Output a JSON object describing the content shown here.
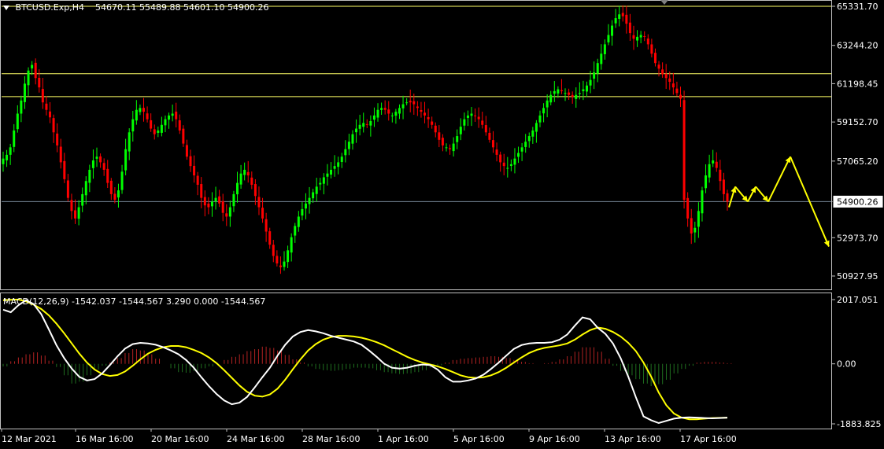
{
  "main_header": {
    "symbol": "BTCUSD.Exp,H4",
    "open": "54670.11",
    "high": "55489.88",
    "low": "54601.10",
    "close": "54900.26"
  },
  "macd_header": {
    "label": "MACD(12,26,9)",
    "values": "-1542.037 -1544.567 3.290 0.000 -1544.567"
  },
  "chart_data": [
    {
      "type": "candlestick",
      "title": "BTCUSD.Exp,H4",
      "ylim": [
        50300,
        65600
      ],
      "price_ticks": [
        "65331.70",
        "63244.20",
        "61198.45",
        "59152.70",
        "57065.20",
        "54900.26",
        "52973.70",
        "50927.95"
      ],
      "current_price": "54900.26",
      "horizontal_levels": [
        65331.7,
        61730,
        60510
      ],
      "colors": {
        "bull": "#00ff00",
        "bear": "#ff0000",
        "level": "#ffff66",
        "current": "#778899",
        "forecast": "#ffff00"
      },
      "x_labels": [
        "12 Mar 2021",
        "16 Mar 16:00",
        "20 Mar 16:00",
        "24 Mar 16:00",
        "28 Mar 16:00",
        "1 Apr 16:00",
        "5 Apr 16:00",
        "9 Apr 16:00",
        "13 Apr 16:00",
        "17 Apr 16:00"
      ],
      "close_path": [
        57200,
        57400,
        57800,
        58700,
        59600,
        60300,
        61200,
        61900,
        62200,
        61500,
        61000,
        60200,
        59800,
        59400,
        58600,
        57900,
        57000,
        56100,
        55100,
        54400,
        54000,
        54600,
        55300,
        56000,
        56600,
        57100,
        57300,
        57000,
        56600,
        55900,
        55300,
        55000,
        55500,
        56500,
        57700,
        58600,
        59300,
        59800,
        59900,
        59700,
        59300,
        58800,
        58500,
        58700,
        59000,
        59300,
        59500,
        59600,
        59300,
        58700,
        58000,
        57300,
        56800,
        56300,
        55800,
        55100,
        54700,
        54600,
        54900,
        55100,
        54800,
        54300,
        54100,
        54600,
        55300,
        55900,
        56400,
        56600,
        56300,
        55800,
        55200,
        54600,
        54000,
        53300,
        52600,
        52000,
        51600,
        51400,
        51700,
        52300,
        53000,
        53600,
        54100,
        54500,
        54800,
        55100,
        55400,
        55700,
        55900,
        56200,
        56400,
        56600,
        56800,
        57000,
        57300,
        57700,
        58100,
        58500,
        58800,
        59000,
        59100,
        59000,
        59200,
        59500,
        59800,
        59900,
        59800,
        59600,
        59500,
        59700,
        59900,
        60100,
        60200,
        60200,
        60100,
        59900,
        59700,
        59500,
        59300,
        59000,
        58600,
        58200,
        57900,
        57800,
        57700,
        58000,
        58400,
        58900,
        59300,
        59500,
        59600,
        59500,
        59300,
        59000,
        58600,
        58200,
        57800,
        57400,
        57000,
        56800,
        56700,
        56900,
        57200,
        57500,
        57800,
        58100,
        58400,
        58700,
        59100,
        59500,
        59900,
        60300,
        60600,
        60800,
        60900,
        60800,
        60700,
        60600,
        60500,
        60600,
        60700,
        60900,
        61100,
        61400,
        61800,
        62300,
        62800,
        63300,
        63800,
        64300,
        64700,
        64900,
        64800,
        64400,
        63900,
        63600,
        63700,
        63800,
        63700,
        63300,
        62800,
        62300,
        62000,
        61700,
        61500,
        61300,
        61000,
        60700,
        60400,
        55000,
        54000,
        53200,
        53500,
        54400,
        55500,
        56300,
        56900,
        57100,
        56700,
        56000,
        55300,
        54900
      ],
      "forecast_path": [
        54600,
        55700,
        54900,
        55700,
        54900,
        57300,
        52500
      ]
    },
    {
      "type": "macd",
      "title": "MACD(12,26,9)",
      "params": [
        12,
        26,
        9
      ],
      "ylim": [
        -2150,
        2150
      ],
      "ticks": [
        "2017.051",
        "0.00",
        "-1883.825"
      ],
      "macd_line": [
        1700,
        1620,
        1840,
        2000,
        1880,
        1560,
        1080,
        580,
        180,
        -150,
        -410,
        -520,
        -480,
        -300,
        -40,
        240,
        480,
        620,
        660,
        640,
        600,
        520,
        420,
        300,
        120,
        -120,
        -420,
        -700,
        -950,
        -1150,
        -1270,
        -1220,
        -1040,
        -740,
        -420,
        -120,
        260,
        600,
        860,
        1000,
        1060,
        1020,
        960,
        880,
        820,
        760,
        700,
        600,
        420,
        220,
        0,
        -120,
        -150,
        -120,
        -60,
        -20,
        -40,
        -180,
        -420,
        -560,
        -560,
        -520,
        -460,
        -340,
        -160,
        40,
        260,
        470,
        590,
        640,
        660,
        660,
        680,
        760,
        920,
        1200,
        1460,
        1400,
        1130,
        940,
        640,
        180,
        -400,
        -1050,
        -1650,
        -1770,
        -1860,
        -1790,
        -1720,
        -1690,
        -1680,
        -1690,
        -1700,
        -1710,
        -1700,
        -1690
      ],
      "signal_line": [
        2000,
        2010,
        2020,
        1960,
        1860,
        1720,
        1520,
        1260,
        960,
        640,
        320,
        40,
        -180,
        -320,
        -380,
        -350,
        -240,
        -60,
        140,
        320,
        440,
        520,
        560,
        560,
        520,
        440,
        340,
        200,
        20,
        -200,
        -440,
        -680,
        -880,
        -1000,
        -1030,
        -960,
        -780,
        -500,
        -170,
        140,
        420,
        620,
        760,
        840,
        880,
        880,
        860,
        820,
        760,
        680,
        580,
        460,
        340,
        220,
        120,
        40,
        -20,
        -80,
        -160,
        -260,
        -360,
        -420,
        -440,
        -420,
        -360,
        -260,
        -120,
        40,
        200,
        340,
        440,
        500,
        540,
        580,
        640,
        760,
        920,
        1060,
        1140,
        1100,
        1000,
        860,
        660,
        400,
        40,
        -400,
        -900,
        -1300,
        -1560,
        -1690,
        -1740,
        -1740,
        -1720,
        -1700,
        -1695,
        -1690
      ],
      "histogram": [
        -80,
        80,
        200,
        300,
        360,
        260,
        100,
        -100,
        -360,
        -620,
        -560,
        -360,
        -180,
        -60,
        40,
        180,
        340,
        460,
        420,
        300,
        160,
        0,
        -140,
        -260,
        -280,
        -220,
        -140,
        -80,
        0,
        120,
        220,
        300,
        400,
        460,
        540,
        500,
        420,
        280,
        140,
        40,
        -80,
        -160,
        -200,
        -220,
        -200,
        -160,
        -120,
        -120,
        -140,
        -200,
        -260,
        -300,
        -320,
        -300,
        -260,
        -200,
        -120,
        -40,
        40,
        120,
        160,
        180,
        200,
        220,
        240,
        220,
        180,
        120,
        60,
        20,
        0,
        20,
        60,
        140,
        240,
        380,
        520,
        520,
        380,
        160,
        -60,
        -220,
        -360,
        -480,
        -620,
        -700,
        -640,
        -500,
        -300,
        -160,
        -60,
        40,
        60,
        60,
        40,
        20
      ]
    }
  ]
}
